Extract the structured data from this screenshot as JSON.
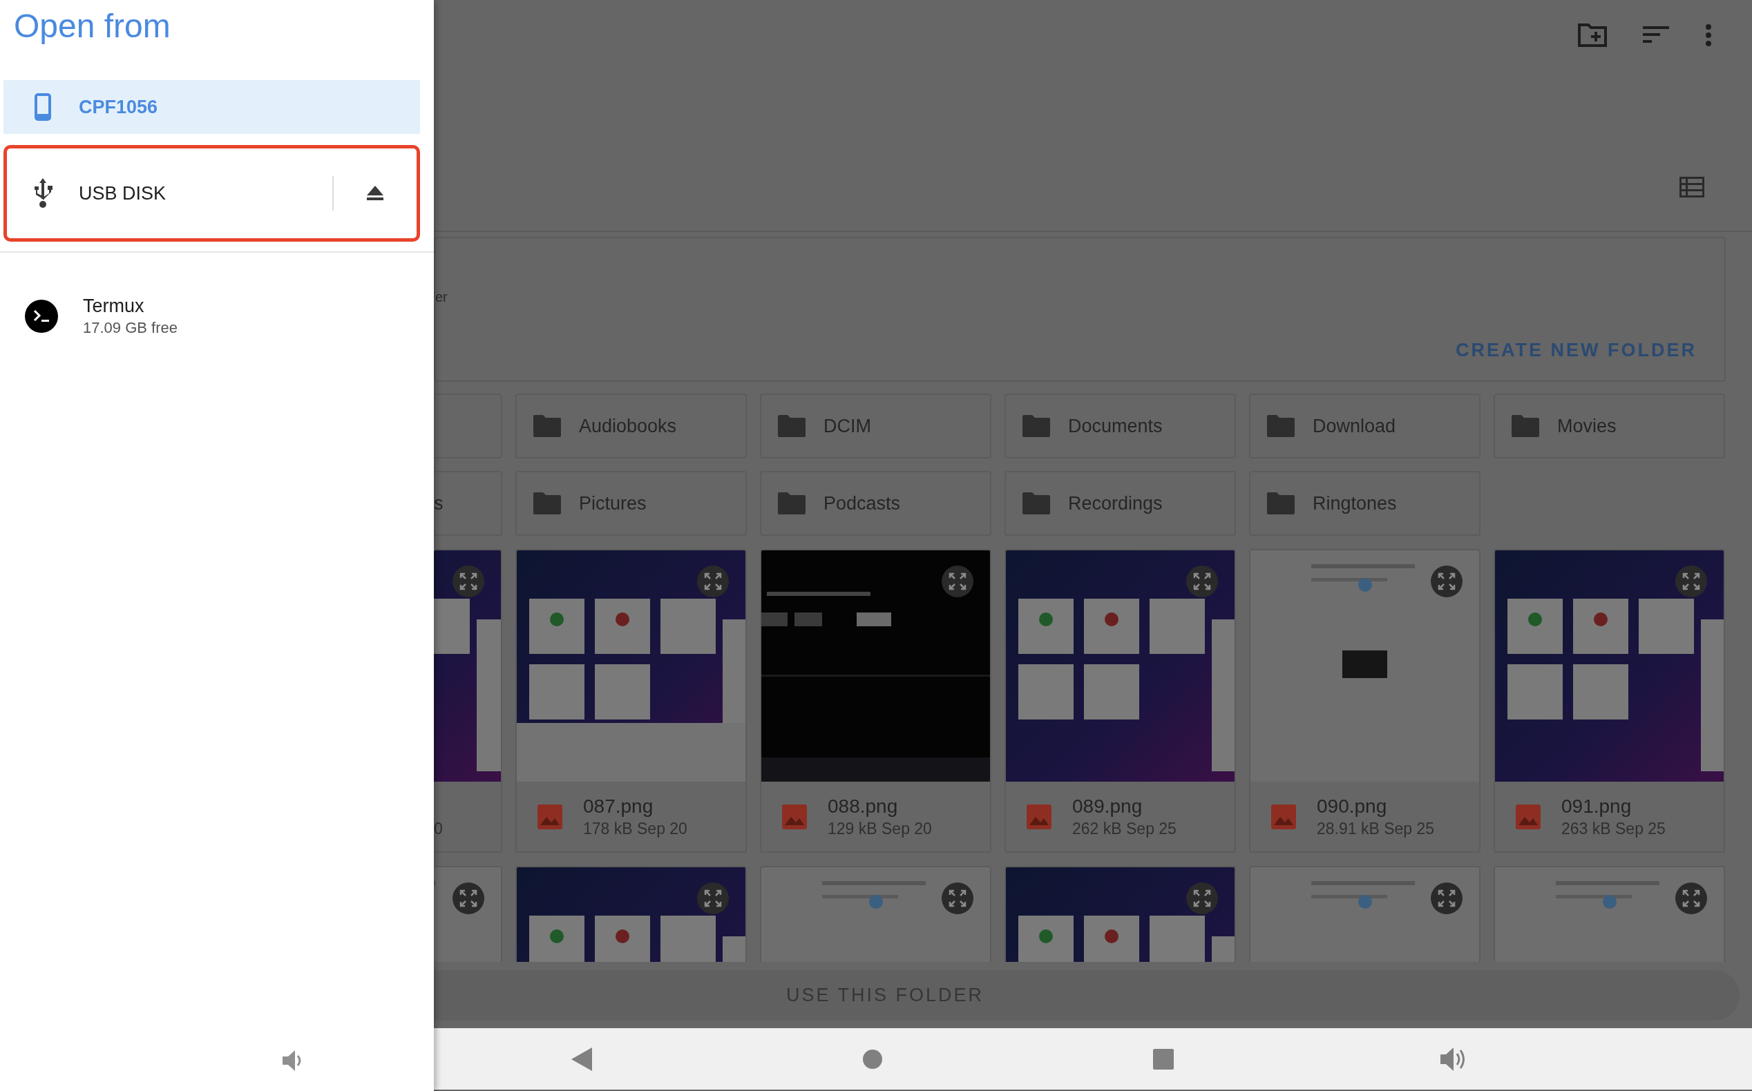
{
  "drawer": {
    "title": "Open from",
    "storage": [
      {
        "kind": "device",
        "label": "CPF1056",
        "selected": true,
        "highlighted": false
      },
      {
        "kind": "usb",
        "label": "USB DISK",
        "selected": false,
        "highlighted": true
      }
    ],
    "apps": [
      {
        "kind": "terminal",
        "label": "Termux",
        "subtitle": "17.09 GB free",
        "selected": false
      }
    ]
  },
  "header_card": {
    "cut_text": "er",
    "action": "CREATE NEW FOLDER"
  },
  "folder_rows": [
    {
      "items": [
        {
          "name": "Audiobooks"
        },
        {
          "name": "DCIM"
        },
        {
          "name": "Documents"
        },
        {
          "name": "Download"
        },
        {
          "name": "Movies"
        }
      ]
    },
    {
      "cut_name": "s",
      "items": [
        {
          "name": "Pictures"
        },
        {
          "name": "Podcasts"
        },
        {
          "name": "Recordings"
        },
        {
          "name": "Ringtones"
        }
      ]
    }
  ],
  "cut_file_details": "0",
  "files": [
    {
      "name": "087.png",
      "details": "178 kB Sep 20"
    },
    {
      "name": "088.png",
      "details": "129 kB Sep 20"
    },
    {
      "name": "089.png",
      "details": "262 kB Sep 25"
    },
    {
      "name": "090.png",
      "details": "28.91 kB Sep 25"
    },
    {
      "name": "091.png",
      "details": "263 kB Sep 25"
    }
  ],
  "action_bar": {
    "label": "USE THIS FOLDER",
    "disabled": true
  }
}
